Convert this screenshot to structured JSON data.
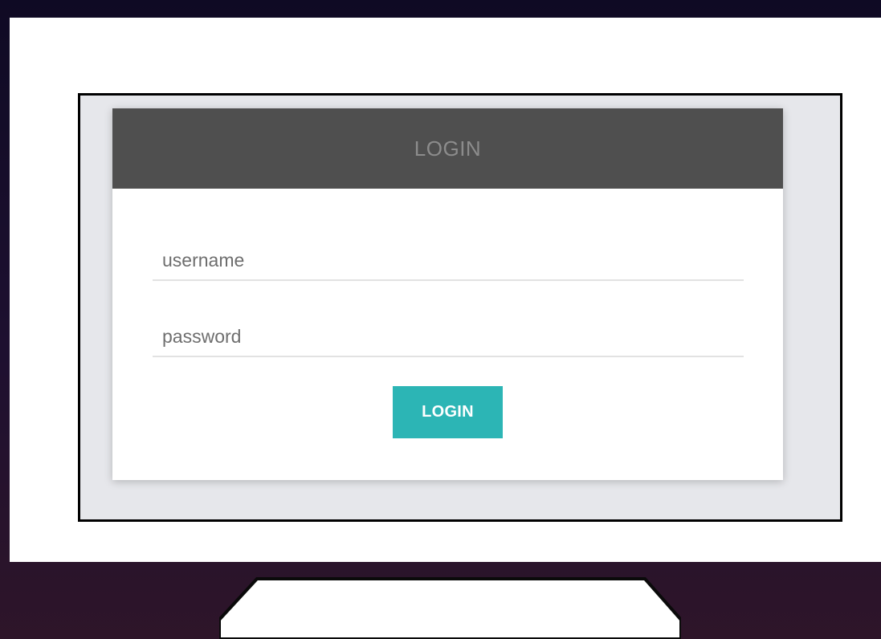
{
  "login_card": {
    "title": "LOGIN",
    "username_placeholder": "username",
    "password_placeholder": "password",
    "submit_label": "LOGIN"
  },
  "colors": {
    "header_background": "#4f4f4f",
    "button_accent": "#2cb5b5",
    "screen_background": "#e6e7eb",
    "backdrop": "#1e1030"
  },
  "icons": [
    "monitor-illustration"
  ]
}
